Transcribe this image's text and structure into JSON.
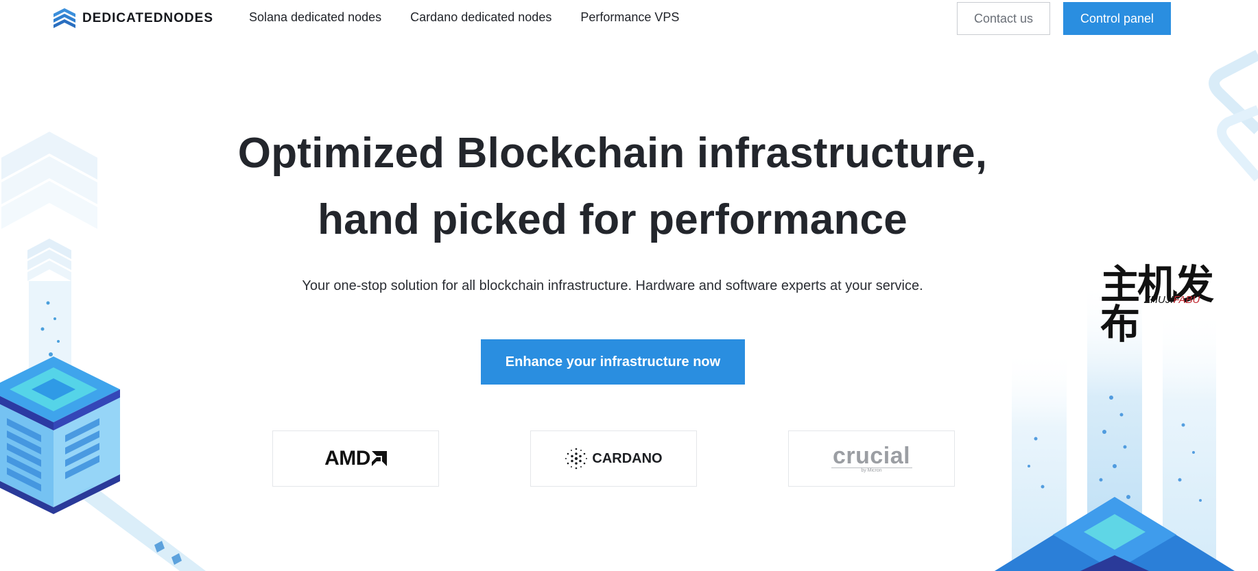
{
  "brand": {
    "name": "DEDICATEDNODES",
    "logo_icon": "stacked-chevrons-icon"
  },
  "nav": {
    "items": [
      "Solana dedicated nodes",
      "Cardano dedicated nodes",
      "Performance VPS"
    ]
  },
  "header": {
    "contact_label": "Contact us",
    "panel_label": "Control panel"
  },
  "hero": {
    "headline_line1": "Optimized Blockchain infrastructure,",
    "headline_line2": "hand picked for performance",
    "subtitle": "Your one-stop solution for all blockchain infrastructure. Hardware and software experts at your service.",
    "cta_label": "Enhance your infrastructure now"
  },
  "partners": {
    "amd": "AMD",
    "cardano": "CARDANO",
    "crucial": "crucial",
    "crucial_sub": "by Micron"
  },
  "watermark": {
    "cn": "主机发布",
    "en_a": "ZHUJI",
    "en_b": "FABU"
  },
  "colors": {
    "accent": "#2a8ee0",
    "text_dark": "#23262c",
    "deco_light": "#e3f1fb",
    "deco_mid": "#57b9ef",
    "deco_dark": "#2a3a99"
  }
}
